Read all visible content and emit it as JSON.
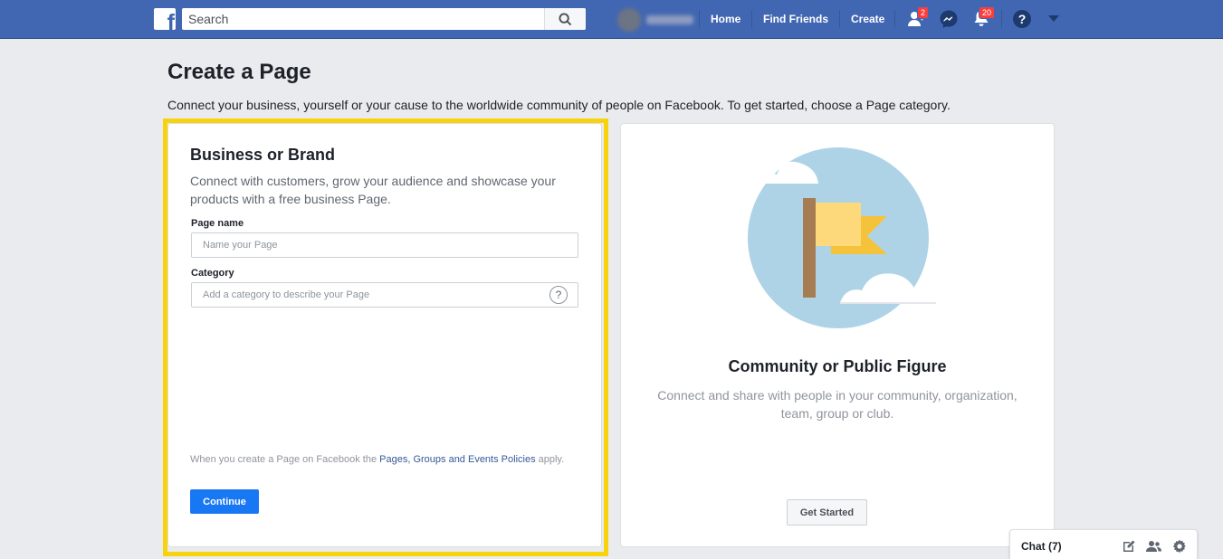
{
  "header": {
    "logo": "f",
    "search_placeholder": "Search",
    "nav": {
      "home": "Home",
      "find_friends": "Find Friends",
      "create": "Create"
    },
    "friend_requests_badge": "2",
    "notifications_badge": "20",
    "bar_color": "#4267b2"
  },
  "main": {
    "title": "Create a Page",
    "subtitle": "Connect your business, yourself or your cause to the worldwide community of people on Facebook. To get started, choose a Page category."
  },
  "business_card": {
    "title": "Business or Brand",
    "description": "Connect with customers, grow your audience and showcase your products with a free business Page.",
    "page_name_label": "Page name",
    "page_name_placeholder": "Name your Page",
    "category_label": "Category",
    "category_placeholder": "Add a category to describe your Page",
    "category_help": "?",
    "policy_prefix": "When you create a Page on Facebook the ",
    "policy_link": "Pages, Groups and Events Policies",
    "policy_suffix": " apply.",
    "continue_label": "Continue",
    "highlight_color": "#f8d30d"
  },
  "community_card": {
    "title": "Community or Public Figure",
    "description": "Connect and share with people in your community, organization, team, group or club.",
    "button_label": "Get Started"
  },
  "chat": {
    "label": "Chat (7)"
  }
}
